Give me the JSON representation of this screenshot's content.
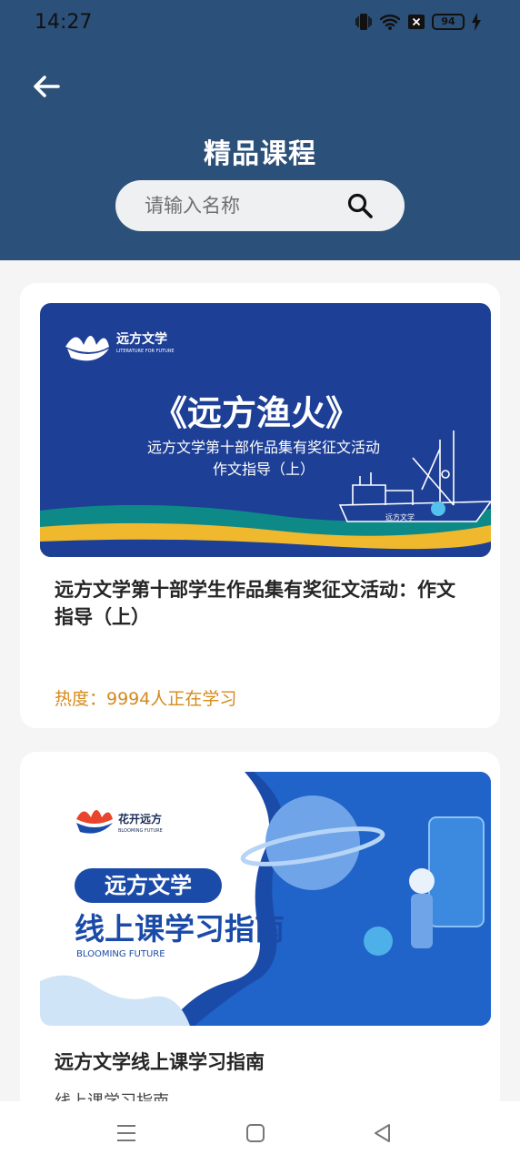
{
  "status": {
    "time": "14:27",
    "battery": "94"
  },
  "header": {
    "title": "精品课程"
  },
  "search": {
    "placeholder": "请输入名称"
  },
  "courses": [
    {
      "banner": {
        "logo_text": "远方文学",
        "logo_sub": "LITERATURE FOR FUTURE",
        "headline": "《远方渔火》",
        "line1": "远方文学第十部作品集有奖征文活动",
        "line2": "作文指导（上）",
        "boat_label": "远方文学"
      },
      "title": "远方文学第十部学生作品集有奖征文活动：作文指导（上）",
      "heat": "热度：9994人正在学习"
    },
    {
      "banner": {
        "logo_text": "花开远方",
        "logo_sub": "BLOOMING FUTURE",
        "pill": "远方文学",
        "headline": "线上课学习指南",
        "sub": "BLOOMING FUTURE"
      },
      "title": "远方文学线上课学习指南",
      "subtitle": "线上课学习指南"
    }
  ],
  "icons": [
    "arrow-left-icon",
    "search-icon",
    "vibrate-icon",
    "wifi-icon",
    "close-box-icon",
    "battery-icon",
    "charging-icon",
    "menu-icon",
    "home-icon",
    "back-icon"
  ]
}
